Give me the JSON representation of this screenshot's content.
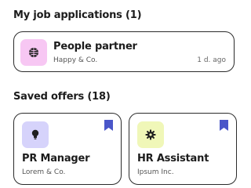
{
  "applications": {
    "title": "My job applications (1)",
    "items": [
      {
        "title": "People partner",
        "company": "Happy & Co.",
        "time": "1 d. ago",
        "icon": "globe-icon",
        "icon_bg": "#f7c7f3"
      }
    ]
  },
  "saved": {
    "title": "Saved offers (18)",
    "items": [
      {
        "title": "PR Manager",
        "company": "Lorem & Co.",
        "icon": "lightbulb-icon",
        "icon_bg": "#d6d3fb",
        "bookmark_icon": "bookmark-icon"
      },
      {
        "title": "HR Assistant",
        "company": "Ipsum Inc.",
        "icon": "gear-icon",
        "icon_bg": "#f0f7b8",
        "bookmark_icon": "bookmark-icon"
      }
    ]
  },
  "colors": {
    "bookmark": "#4a56c9",
    "border": "#2b2b2b"
  }
}
